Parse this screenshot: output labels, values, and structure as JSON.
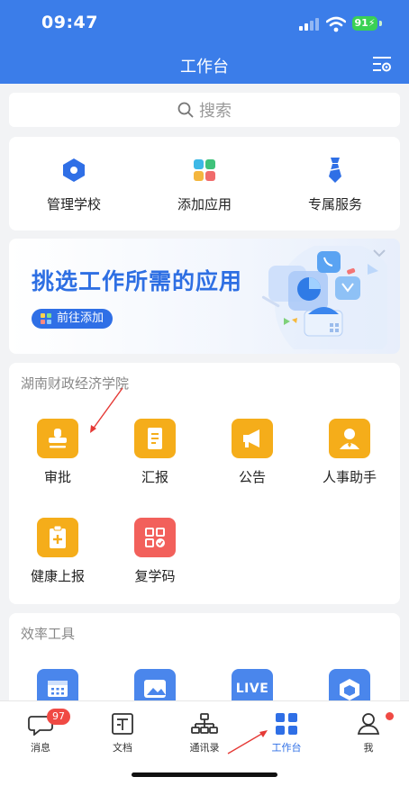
{
  "status_bar": {
    "time": "09:47",
    "battery": "91"
  },
  "header": {
    "title": "工作台"
  },
  "search": {
    "placeholder": "搜索"
  },
  "quick_actions": [
    {
      "label": "管理学校",
      "icon": "hexagon-icon",
      "color": "#2f6fe6"
    },
    {
      "label": "添加应用",
      "icon": "app-grid-icon",
      "color": "#3b7de9"
    },
    {
      "label": "专属服务",
      "icon": "tie-icon",
      "color": "#2f6fe6"
    }
  ],
  "banner": {
    "title": "挑选工作所需的应用",
    "button": "前往添加"
  },
  "school_section": {
    "title": "湖南财政经济学院",
    "apps": [
      {
        "label": "审批",
        "icon": "stamp-icon",
        "color": "#f5ad1a"
      },
      {
        "label": "汇报",
        "icon": "report-icon",
        "color": "#f5ad1a"
      },
      {
        "label": "公告",
        "icon": "megaphone-icon",
        "color": "#f5ad1a"
      },
      {
        "label": "人事助手",
        "icon": "person-icon",
        "color": "#f5ad1a"
      },
      {
        "label": "健康上报",
        "icon": "health-clipboard-icon",
        "color": "#f5ad1a"
      },
      {
        "label": "复学码",
        "icon": "qr-code-icon",
        "color": "#f2605b"
      }
    ]
  },
  "tools_section": {
    "title": "效率工具",
    "tool_icons": [
      "calendar-icon",
      "image-icon",
      "live-icon",
      "box-icon"
    ],
    "live_text": "LIVE",
    "color": "#4a86ec"
  },
  "tabbar": {
    "tabs": [
      {
        "label": "消息",
        "icon": "chat-bubble-icon"
      },
      {
        "label": "文档",
        "icon": "document-icon"
      },
      {
        "label": "通讯录",
        "icon": "org-chart-icon"
      },
      {
        "label": "工作台",
        "icon": "grid-icon"
      },
      {
        "label": "我",
        "icon": "user-icon"
      }
    ],
    "active": "工作台",
    "messages_badge": "97"
  }
}
